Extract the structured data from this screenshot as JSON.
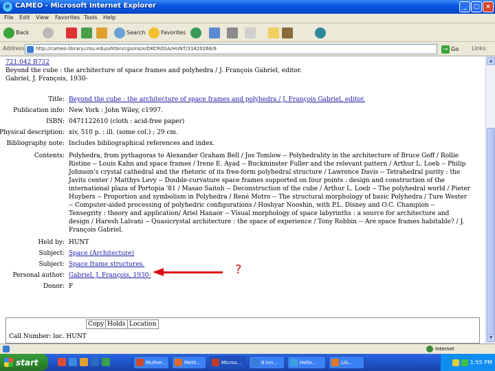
{
  "window": {
    "title": "CAMEO - Microsoft Internet Explorer"
  },
  "menu": [
    "File",
    "Edit",
    "View",
    "Favorites",
    "Tools",
    "Help"
  ],
  "toolbar": {
    "back": "Back",
    "search": "Search",
    "favorites": "Favorites"
  },
  "address": {
    "label": "Address",
    "url": "http://cameo.library.cmu.edu/uhtbin/cgisirsi/x/DKCROSA/HUNT/31820268/9",
    "go": "Go",
    "links": "Links"
  },
  "record": {
    "call_number": "721.042 B732",
    "title_line": "Beyond the cube : the architecture of space frames and polyhedra / J. François Gabriel, editor.",
    "author_line": "Gabriel, J. François, 1930-",
    "fields": [
      {
        "label": "Title:",
        "value": "Beyond the cube : the architecture of space frames and polyhedra / J. François Gabriel, editor.",
        "link": true
      },
      {
        "label": "Publication info:",
        "value": "New York : John Wiley, c1997.",
        "link": false
      },
      {
        "label": "ISBN:",
        "value": "0471122610 (cloth : acid-free paper)",
        "link": false
      },
      {
        "label": "Physical description:",
        "value": "xiv, 510 p. : ill. (some col.) ; 29 cm.",
        "link": false
      },
      {
        "label": "Bibliography note:",
        "value": "Includes bibliographical references and index.",
        "link": false
      }
    ],
    "contents_label": "Contents:",
    "contents_lines": [
      "Polyhedra, from pythagoras to Alexander Graham Bell / Jos Tomlow -- Polyhedrality in the architecture of Bruce Goff / Rollie",
      "Ristine -- Louis Kahn and space frames / Irene E. Ayad -- Buckminster Fuller and the relevant pattern / Arthur L. Loeb -- Philip",
      "Johnson's crystal cathedral and the rhetoric of its free-form polyhedral structure / Lawrence Davis -- Tetrahedral purity : the",
      "Javits center / Matthys Levy -- Double-curvature space frames supported on four points : design and construction of the",
      "international plaza of Portopia '81 / Masao Saitoh -- Deconstruction of the cube / Arthur L. Loeb -- The polyhedral world / Pieter",
      "Huybers -- Proportion and symbolism in Polyhedra / René Motro -- The structural morphology of basic Polyhedra / Ture Wester",
      "-- Computer-aided processing of polyhedric configurations / Hoshyar Nooshin, with P.L. Disney and O.C. Champion --",
      "Tensegrity : theory and application/ Ariel Hanaor -- Visual morphology of space labyrinths : a source for architecture and",
      "design / Haresh Lalvani -- Quasicrystal architecture : the space of experience / Tony Robbin -- Are space frames habitable? / J.",
      "François Gabriel."
    ],
    "held_by": {
      "label": "Held by:",
      "value": "HUNT"
    },
    "subjects": [
      {
        "label": "Subject:",
        "value": "Space (Architecture)"
      },
      {
        "label": "Subject:",
        "value": "Space frame structures."
      }
    ],
    "personal_author": {
      "label": "Personal author:",
      "value": "Gabriel, J. François, 1930-"
    },
    "donor": {
      "label": "Donor:",
      "value": "F"
    }
  },
  "annotation": {
    "mark": "?"
  },
  "holdings": {
    "columns": [
      "Copy",
      "Holds",
      "Location"
    ],
    "call_number_row": "Call Number: loc. HUNT"
  },
  "status": {
    "zone": "Internet"
  },
  "taskbar": {
    "start": "start",
    "tasks": [
      "Mulher...",
      "Meth...",
      "Micros...",
      "8 Inn...",
      "Hello...",
      "Lib..."
    ],
    "clock": "1:55 PM"
  },
  "colors": {
    "link": "#1a1aa6",
    "annotation": "#e01010",
    "titlebar": "#0a58e0"
  }
}
